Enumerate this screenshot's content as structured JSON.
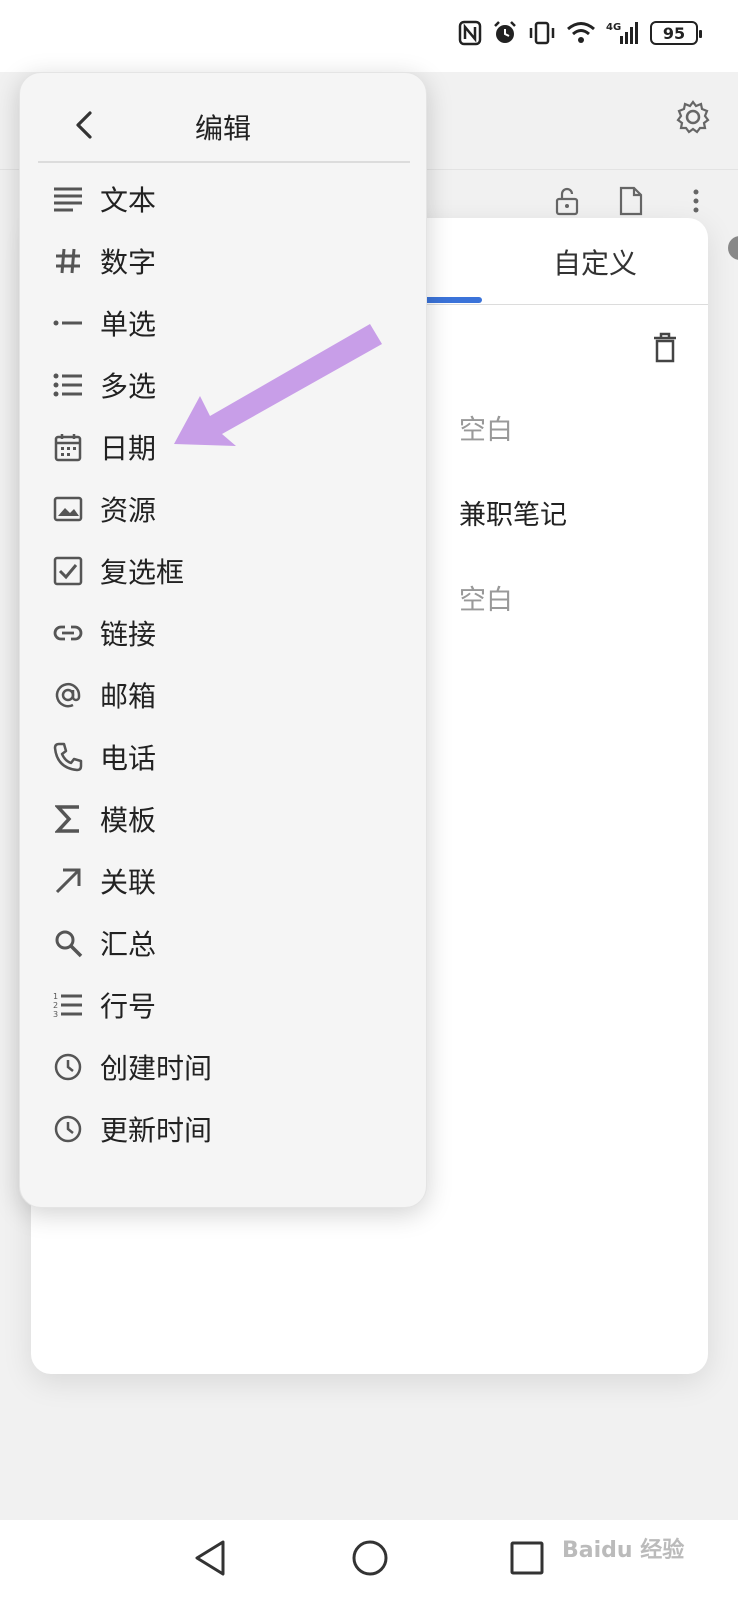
{
  "status_bar": {
    "battery": "95",
    "network": "4G"
  },
  "menu": {
    "title": "编辑",
    "items": [
      {
        "label": "文本",
        "icon": "text-icon"
      },
      {
        "label": "数字",
        "icon": "hash-icon"
      },
      {
        "label": "单选",
        "icon": "single-select-icon"
      },
      {
        "label": "多选",
        "icon": "list-icon"
      },
      {
        "label": "日期",
        "icon": "calendar-icon"
      },
      {
        "label": "资源",
        "icon": "image-icon"
      },
      {
        "label": "复选框",
        "icon": "checkbox-icon"
      },
      {
        "label": "链接",
        "icon": "link-icon"
      },
      {
        "label": "邮箱",
        "icon": "at-icon"
      },
      {
        "label": "电话",
        "icon": "phone-icon"
      },
      {
        "label": "模板",
        "icon": "sigma-icon"
      },
      {
        "label": "关联",
        "icon": "arrow-up-right-icon"
      },
      {
        "label": "汇总",
        "icon": "search-icon"
      },
      {
        "label": "行号",
        "icon": "numbered-list-icon"
      },
      {
        "label": "创建时间",
        "icon": "clock-icon"
      },
      {
        "label": "更新时间",
        "icon": "clock-icon"
      }
    ]
  },
  "sheet": {
    "tab_custom": "自定义",
    "rows": [
      {
        "value": "空白",
        "empty": true
      },
      {
        "value": "兼职笔记",
        "empty": false
      },
      {
        "value": "空白",
        "empty": true
      }
    ]
  },
  "watermark": "Baidu 经验",
  "colors": {
    "tab_indicator": "#3b73d9",
    "annotation_arrow": "#c89ee8"
  }
}
